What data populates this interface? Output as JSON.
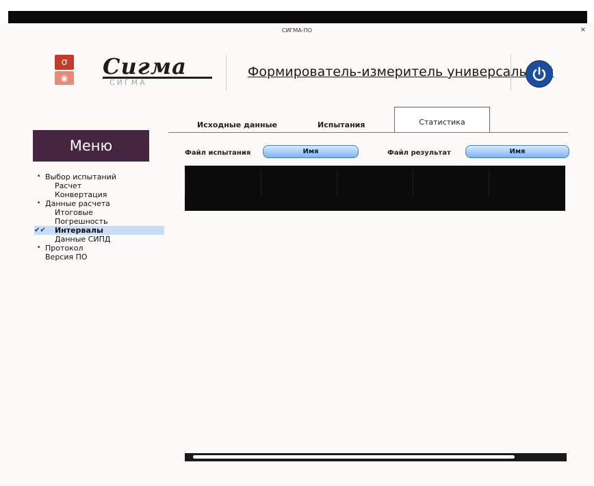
{
  "window": {
    "title": "СИГМА-ПО",
    "close_glyph": "×"
  },
  "header": {
    "brand": "Сигма",
    "brand_sub": "СИГМА",
    "app_title": "Формирователь-измеритель универсальный",
    "icons": {
      "logo": "sigma-logo-icon",
      "power": "power-icon"
    },
    "accent_color": "#45263e"
  },
  "menu": {
    "title": "Меню",
    "items": [
      {
        "label": "Выбор испытаний",
        "level": 0,
        "bullet": "•"
      },
      {
        "label": "Расчет",
        "level": 1
      },
      {
        "label": "Конвертация",
        "level": 1
      },
      {
        "label": "Данные расчета",
        "level": 0,
        "bullet": "•"
      },
      {
        "label": "Итоговые",
        "level": 1
      },
      {
        "label": "Погрешность",
        "level": 1
      },
      {
        "label": "Интервалы",
        "level": 1,
        "active": true,
        "check": "✔✔"
      },
      {
        "label": "Данные СИПД",
        "level": 1
      },
      {
        "label": "Протокол",
        "level": 0,
        "bullet": "•"
      },
      {
        "label": "Версия ПО",
        "level": 0
      }
    ]
  },
  "tabs": [
    {
      "label": "Исходные данные"
    },
    {
      "label": "Испытания"
    },
    {
      "label": "Статистика",
      "selected": true
    }
  ],
  "files": {
    "test_label": "Файл испытания",
    "test_button": "Имя",
    "result_label": "Файл результат",
    "result_button": "Имя"
  }
}
